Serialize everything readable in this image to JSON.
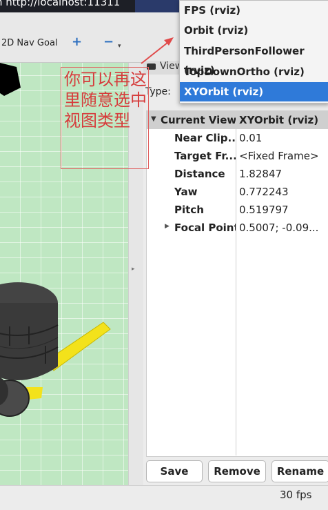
{
  "topbar": {
    "url_text": "n http://localhost:11311"
  },
  "toolbar": {
    "nav_goal_label": "2D Nav Goal",
    "plus_icon": "+",
    "minus_icon": "−",
    "minus_caret": "▾"
  },
  "views": {
    "panel_label": "Views",
    "type_label": "Type:",
    "dropdown": {
      "items": [
        "FPS (rviz)",
        "Orbit (rviz)",
        "ThirdPersonFollower (rviz)",
        "TopDownOrtho (rviz)",
        "XYOrbit (rviz)"
      ],
      "selected": "XYOrbit (rviz)"
    },
    "properties": {
      "current_view": {
        "name": "Current View",
        "value": "XYOrbit (rviz)"
      },
      "rows": [
        {
          "name": "Near Clip...",
          "value": "0.01"
        },
        {
          "name": "Target Fr...",
          "value": "<Fixed Frame>"
        },
        {
          "name": "Distance",
          "value": "1.82847"
        },
        {
          "name": "Yaw",
          "value": "0.772243"
        },
        {
          "name": "Pitch",
          "value": "0.519797"
        },
        {
          "name": "Focal Point",
          "value": "0.5007; -0.09..."
        }
      ]
    },
    "buttons": {
      "save": "Save",
      "remove": "Remove",
      "rename": "Rename"
    }
  },
  "status": {
    "fps": "30 fps"
  },
  "annotation": {
    "text": "你可以再这里随意选中视图类型",
    "color": "#d63c3c"
  },
  "colors": {
    "grid_floor": "#bfe7c2",
    "selection": "#2f7ad9",
    "robot_body": "#3a3a3a",
    "robot_arm": "#f3e21b"
  }
}
